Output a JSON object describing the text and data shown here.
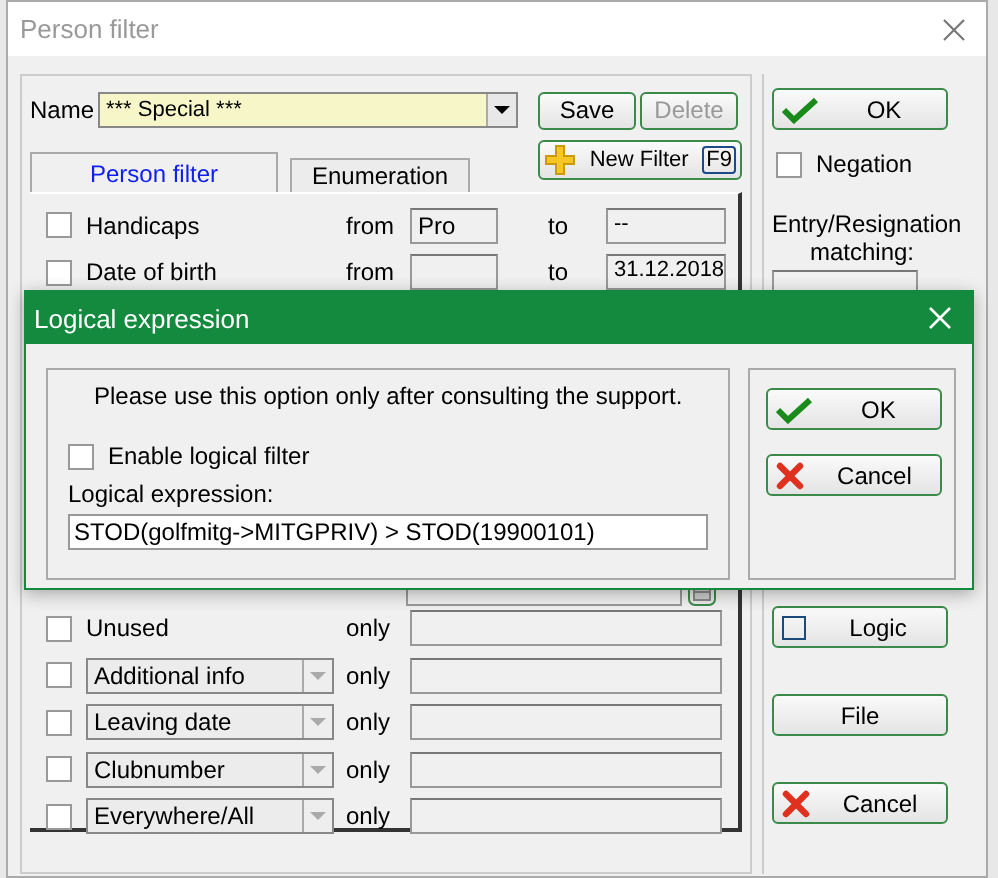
{
  "window": {
    "title": "Person filter"
  },
  "name_field": {
    "label": "Name",
    "value": "*** Special ***"
  },
  "save_button": {
    "label": "Save",
    "disabled": false
  },
  "delete_button": {
    "label": "Delete",
    "disabled": true
  },
  "new_filter_button": {
    "label": "New Filter",
    "shortcut": "F9"
  },
  "tabs": [
    {
      "label": "Person filter",
      "selected": true
    },
    {
      "label": "Enumeration",
      "selected": false
    }
  ],
  "criteria": [
    {
      "kind": "range",
      "label": "Handicaps",
      "checked": false,
      "from_label": "from",
      "from": "Pro",
      "to_label": "to",
      "to": "--"
    },
    {
      "kind": "range",
      "label": "Date of birth",
      "checked": false,
      "from_label": "from",
      "to_label": "to",
      "to": "31.12.2018"
    },
    {
      "kind": "covered"
    },
    {
      "kind": "only",
      "label": "Unused",
      "checked": false,
      "only_label": "only"
    },
    {
      "kind": "select",
      "label": "Additional info",
      "checked": false,
      "only_label": "only"
    },
    {
      "kind": "select",
      "label": "Leaving date",
      "checked": false,
      "only_label": "only"
    },
    {
      "kind": "select",
      "label": "Clubnumber",
      "checked": false,
      "only_label": "only"
    },
    {
      "kind": "select",
      "label": "Everywhere/All",
      "checked": false,
      "only_label": "only"
    }
  ],
  "side": {
    "ok": "OK",
    "negation": {
      "label": "Negation",
      "checked": false
    },
    "matching_label": "Entry/Resignation matching:",
    "logic": {
      "label": "Logic",
      "checked": false
    },
    "file": "File",
    "cancel": "Cancel"
  },
  "dialog": {
    "title": "Logical expression",
    "notice": "Please use this option only after consulting the support.",
    "enable": {
      "label": "Enable logical filter",
      "checked": false
    },
    "expression_label": "Logical expression:",
    "expression": "STOD(golfmitg->MITGPRIV) > STOD(19900101)",
    "ok": "OK",
    "cancel": "Cancel"
  }
}
